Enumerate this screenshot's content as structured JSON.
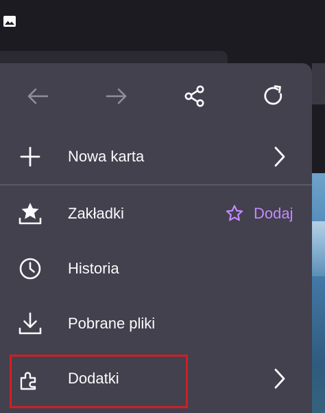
{
  "status_bar": {
    "icon": "image-icon"
  },
  "navigation": {
    "back_icon": "arrow-left-icon",
    "forward_icon": "arrow-right-icon",
    "share_icon": "share-icon",
    "reload_icon": "reload-icon"
  },
  "menu": {
    "new_tab": {
      "label": "Nowa karta",
      "icon": "plus-icon"
    },
    "bookmarks": {
      "label": "Zakładki",
      "icon": "star-tray-icon",
      "add_label": "Dodaj",
      "add_icon": "star-outline-icon"
    },
    "history": {
      "label": "Historia",
      "icon": "clock-icon"
    },
    "downloads": {
      "label": "Pobrane pliki",
      "icon": "download-icon"
    },
    "addons": {
      "label": "Dodatki",
      "icon": "puzzle-icon"
    }
  },
  "colors": {
    "menu_bg": "#42414d",
    "text": "#fbfbfe",
    "accent": "#c689ff",
    "highlight": "#d51c24",
    "disabled": "#8f8f9d"
  }
}
